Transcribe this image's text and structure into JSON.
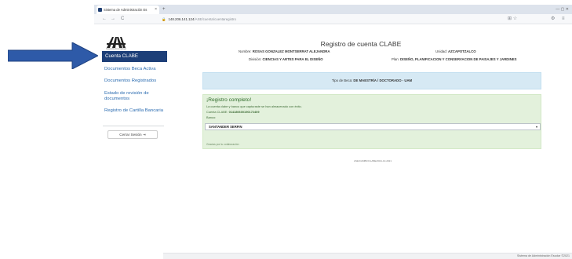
{
  "browser": {
    "tab_title": "Sistema de Administración Es",
    "tab_close": "×",
    "new_tab": "+",
    "window_controls": "—   ▢   ✕",
    "nav_back": "←",
    "nav_forward": "→",
    "nav_reload": "C",
    "url_host": "148.206.141.124",
    "url_path": "/ASE/cuenta/cuentaregistro",
    "toolbar_icons": "⊞   ☆",
    "menu_icon": "⚙",
    "menu_dots": "≡"
  },
  "sidebar": {
    "logo_text": "Casa abierta al tiempo",
    "items": [
      {
        "label": "Cuenta CLABE",
        "active": true
      },
      {
        "label": "Documentos Beca Activa"
      },
      {
        "label": "Documentos Registrados"
      },
      {
        "label": "Estado de revisión de documentos"
      },
      {
        "label": "Registro de Cartilla Bancaria"
      }
    ],
    "logout_label": "Cerrar Sesión",
    "logout_icon": "⇥"
  },
  "main": {
    "title": "Registro de cuenta CLABE",
    "nombre_label": "Nombre:",
    "nombre_value": "ROSAS GONZALEZ MONTSERRAT ALEJANDRA",
    "unidad_label": "Unidad:",
    "unidad_value": "AZCAPOTZALCO",
    "division_label": "División:",
    "division_value": "CIENCIAS Y ARTES PARA EL DISEÑO",
    "plan_label": "Plan:",
    "plan_value": "DISEÑO, PLANIFICACION Y CONSERVACION DE PAISAJES Y JARDINES",
    "beca_label": "Tipo de Beca:",
    "beca_value": "DE MAESTRÍA / DOCTORADO - UAM",
    "success": {
      "title": "¡Registro completo!",
      "description": "La cuenta clabe y banco que capturaste se han almacenado con éxito.",
      "cuenta_label": "Cuenta CLABE:",
      "cuenta_value": "014180600190172409",
      "banco_label": "Banco:",
      "bank_selected": "SANTANDER SERFIN",
      "bank_caret": "▾",
      "note": "Gracias por tu colaboración"
    },
    "footer_code": "ASE/CAMBIOCLABE/2021-10-2021"
  },
  "bottom": {
    "text": "Sistema de Administración Escolar ©2021"
  },
  "colors": {
    "sidebar_active": "#1d3f78",
    "arrow": "#2e5aa8",
    "info_bg": "#d6e9f4",
    "success_bg": "#e3f1dc"
  }
}
